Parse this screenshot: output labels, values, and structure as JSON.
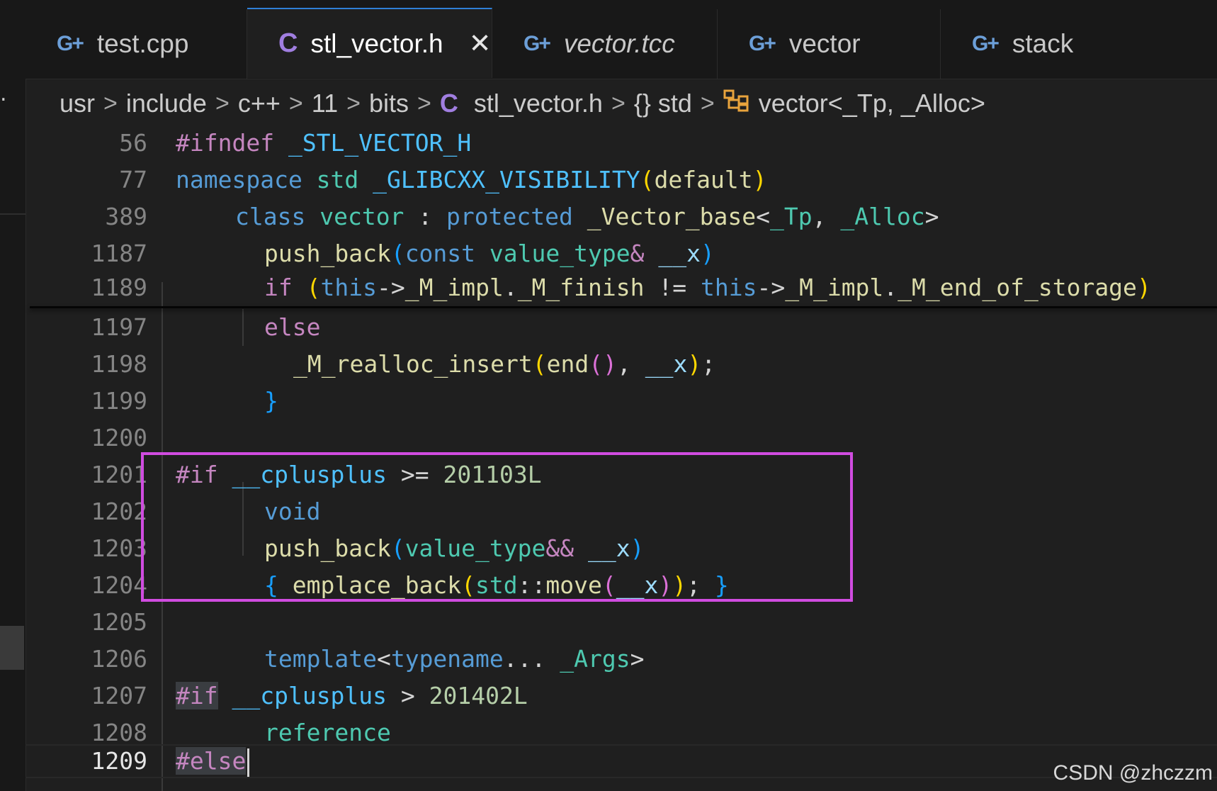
{
  "tabs": [
    {
      "icon": "G+",
      "label": "test.cpp"
    },
    {
      "icon": "C",
      "label": "stl_vector.h",
      "close": "✕"
    },
    {
      "icon": "G+",
      "label": "vector.tcc"
    },
    {
      "icon": "G+",
      "label": "vector"
    },
    {
      "icon": "G+",
      "label": "stack"
    }
  ],
  "breadcrumb": {
    "segments": [
      "usr",
      "include",
      "c++",
      "11",
      "bits"
    ],
    "file_icon": "C",
    "file": "stl_vector.h",
    "namespace_icon": "{}",
    "namespace": "std",
    "class": "vector<_Tp, _Alloc>",
    "separator": ">"
  },
  "code": {
    "line_numbers": [
      "56",
      "77",
      "389",
      "1187",
      "1189",
      "1197",
      "1198",
      "1199",
      "1200",
      "1201",
      "1202",
      "1203",
      "1204",
      "1205",
      "1206",
      "1207",
      "1208",
      "1209"
    ],
    "current_line": "1209",
    "l56": {
      "t1": "#ifndef",
      "t2": " _STL_VECTOR_H"
    },
    "l77": {
      "t1": "namespace",
      "t2": " std ",
      "t3": "_GLIBCXX_VISIBILITY",
      "t4": "(",
      "t5": "default",
      "t6": ")"
    },
    "l389": {
      "t1": "class",
      "t2": " ",
      "t3": "vector",
      "t4": " : ",
      "t5": "protected",
      "t6": " ",
      "t7": "_Vector_base",
      "t8": "<",
      "t9": "_Tp",
      "t10": ", ",
      "t11": "_Alloc",
      "t12": ">"
    },
    "l1187": {
      "t1": "push_back",
      "t2": "(",
      "t3": "const",
      "t4": " ",
      "t5": "value_type",
      "t6": "&",
      "t7": " ",
      "t8": "__x",
      "t9": ")"
    },
    "l1189": {
      "t1": "if",
      "t2": " ",
      "t3": "(",
      "t4": "this",
      "t5": "->",
      "t6": "_M_impl",
      "t7": ".",
      "t8": "_M_finish",
      "t9": " != ",
      "t10": "this",
      "t11": "->",
      "t12": "_M_impl",
      "t13": ".",
      "t14": "_M_end_of_storage",
      "t15": ")"
    },
    "l1197": {
      "t1": "else"
    },
    "l1198": {
      "t1": "_M_realloc_insert",
      "t2": "(",
      "t3": "end",
      "t4": "()",
      "t5": ", ",
      "t6": "__x",
      "t7": ")",
      "t8": ";"
    },
    "l1199": {
      "t1": "}"
    },
    "l1201": {
      "t1": "#if",
      "t2": " ",
      "t3": "__cplusplus",
      "t4": " >= ",
      "t5": "201103L"
    },
    "l1202": {
      "t1": "void"
    },
    "l1203": {
      "t1": "push_back",
      "t2": "(",
      "t3": "value_type",
      "t4": "&&",
      "t5": " ",
      "t6": "__x",
      "t7": ")"
    },
    "l1204": {
      "t1": "{",
      "t2": " ",
      "t3": "emplace_back",
      "t4": "(",
      "t5": "std",
      "t6": "::",
      "t7": "move",
      "t8": "(",
      "t9": "__x",
      "t10": ")",
      "t11": ")",
      "t12": ";",
      "t13": " ",
      "t14": "}"
    },
    "l1206": {
      "t1": "template",
      "t2": "<",
      "t3": "typename",
      "t4": "...",
      "t5": " ",
      "t6": "_Args",
      "t7": ">"
    },
    "l1207": {
      "t1": "#if",
      "t2": " ",
      "t3": "__cplusplus",
      "t4": " > ",
      "t5": "201402L"
    },
    "l1208": {
      "t1": "reference"
    },
    "l1209": {
      "t1": "#else"
    }
  },
  "watermark": "CSDN @zhczzm"
}
